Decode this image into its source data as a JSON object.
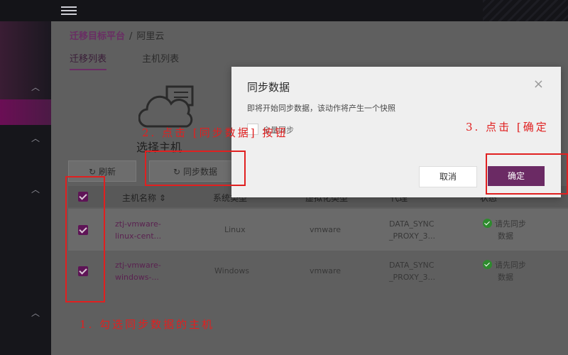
{
  "breadcrumb": {
    "root": "迁移目标平台",
    "separator": "/",
    "current": "阿里云"
  },
  "tabs": [
    {
      "label": "迁移列表",
      "active": true
    },
    {
      "label": "主机列表",
      "active": false
    }
  ],
  "empty_state": {
    "title": "选择主机"
  },
  "toolbar": {
    "refresh_label": "刷新",
    "sync_label": "同步数据"
  },
  "table": {
    "headers": [
      "主机名称",
      "系统类型",
      "虚拟化类型",
      "代理",
      "状态"
    ],
    "rows": [
      {
        "checked": true,
        "name": "ztj-vmware-linux-cent...",
        "name_line1": "ztj-vmware-",
        "name_line2": "linux-cent...",
        "os": "Linux",
        "virt": "vmware",
        "proxy_line1": "DATA_SYNC",
        "proxy_line2": "_PROXY_3...",
        "status_line1": "请先同步",
        "status_line2": "数据"
      },
      {
        "checked": true,
        "name": "ztj-vmware-windows-...",
        "name_line1": "ztj-vmware-",
        "name_line2": "windows-...",
        "os": "Windows",
        "virt": "vmware",
        "proxy_line1": "DATA_SYNC",
        "proxy_line2": "_PROXY_3...",
        "status_line1": "请先同步",
        "status_line2": "数据"
      }
    ]
  },
  "modal": {
    "title": "同步数据",
    "close": "×",
    "description": "即将开始同步数据，该动作将产生一个快照",
    "checkbox_label": "全量同步",
    "cancel_label": "取消",
    "confirm_label": "确定"
  },
  "annotations": {
    "step1": "1. 勾选同步数据的主机",
    "step2": "2. 点击 [同步数据] 按钮",
    "step3": "3. 点击 [确定"
  },
  "colors": {
    "accent": "#6b2a64",
    "annotation": "#e02020",
    "status_ok": "#2e8a2e"
  }
}
